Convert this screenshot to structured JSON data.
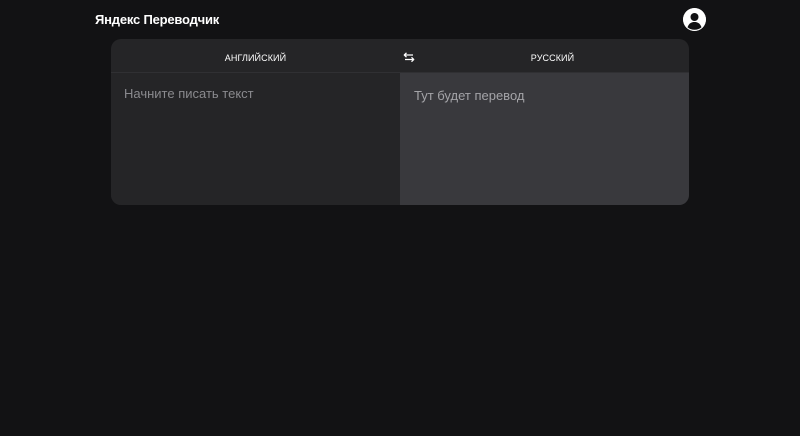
{
  "header": {
    "logo": "Яндекс Переводчик"
  },
  "translator": {
    "source_language": "АНГЛИЙСКИЙ",
    "target_language": "РУССКИЙ",
    "input": {
      "value": "",
      "placeholder": "Начните писать текст"
    },
    "output_placeholder": "Тут будет перевод"
  },
  "icons": {
    "avatar": "user-avatar-icon",
    "swap": "swap-languages-icon"
  },
  "colors": {
    "background": "#121214",
    "card": "#252527",
    "output_pane": "#39393d",
    "text": "#ffffff",
    "placeholder": "#8a8a8e"
  }
}
